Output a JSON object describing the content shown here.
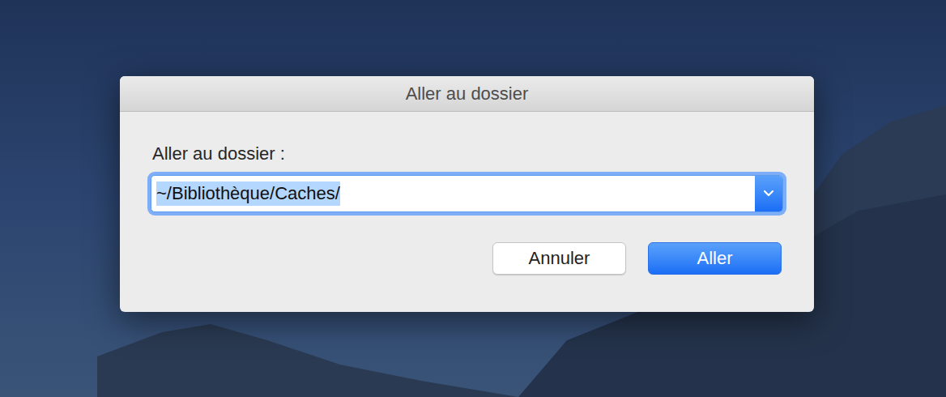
{
  "window": {
    "title": "Aller au dossier"
  },
  "label": "Aller au dossier :",
  "field": {
    "value": "~/Bibliothèque/Caches/",
    "selected": true,
    "focused": true
  },
  "buttons": [
    {
      "label": "Annuler",
      "default": false
    },
    {
      "label": "Aller",
      "default": true
    }
  ]
}
